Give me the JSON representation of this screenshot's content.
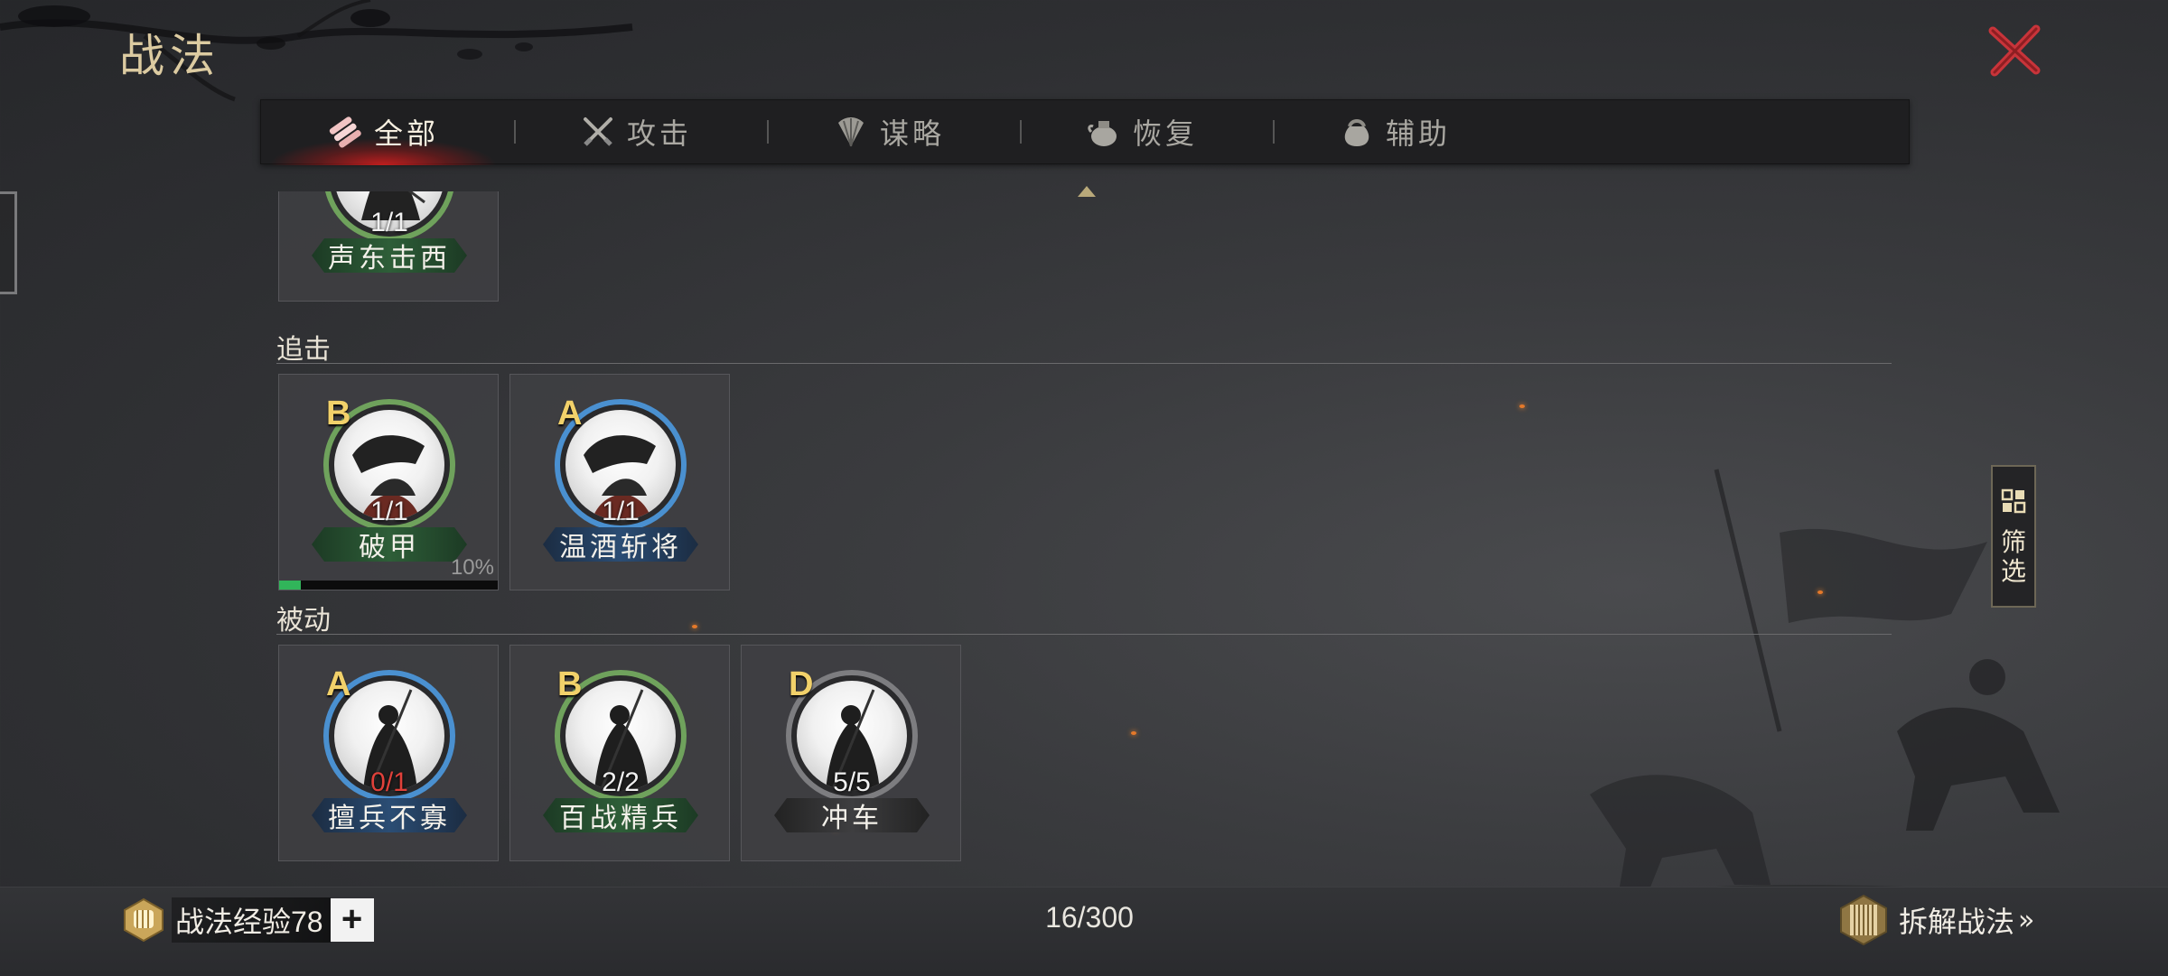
{
  "window": {
    "title": "战法",
    "close_icon": "close-icon"
  },
  "tabs": [
    {
      "label": "全部",
      "icon": "all-scrolls-icon",
      "active": true
    },
    {
      "label": "攻击",
      "icon": "crossed-swords-icon",
      "active": false
    },
    {
      "label": "谋略",
      "icon": "feather-fan-icon",
      "active": false
    },
    {
      "label": "恢复",
      "icon": "medicine-pot-icon",
      "active": false
    },
    {
      "label": "辅助",
      "icon": "pouch-icon",
      "active": false
    }
  ],
  "sections": [
    {
      "title": "",
      "cards": [
        {
          "grade": "",
          "count": "1/1",
          "name": "声东击西",
          "tier_color": "green"
        }
      ]
    },
    {
      "title": "追击",
      "cards": [
        {
          "grade": "B",
          "count": "1/1",
          "name": "破甲",
          "tier_color": "green",
          "progress_pct": "10%",
          "progress": 0.1
        },
        {
          "grade": "A",
          "count": "1/1",
          "name": "温酒斩将",
          "tier_color": "blue"
        }
      ]
    },
    {
      "title": "被动",
      "cards": [
        {
          "grade": "A",
          "count": "0/1",
          "count_color": "#e0413a",
          "name": "擅兵不寡",
          "tier_color": "blue"
        },
        {
          "grade": "B",
          "count": "2/2",
          "name": "百战精兵",
          "tier_color": "green"
        },
        {
          "grade": "D",
          "count": "5/5",
          "name": "冲车",
          "tier_color": "gray"
        }
      ]
    }
  ],
  "filter": {
    "label": "筛选",
    "icon": "grid-icon"
  },
  "footer": {
    "exp_label": "战法经验78",
    "exp_icon": "fist-badge-icon",
    "add_label": "+",
    "capacity": "16/300",
    "dismantle_label": "拆解战法",
    "dismantle_icon": "scroll-bundle-icon",
    "dismantle_chevron": "»"
  },
  "colors": {
    "accent_gold": "#dccba1",
    "close_red": "#c8343a",
    "active_tab_glow": "#dc1e1e",
    "progress_green": "#31b55a"
  }
}
